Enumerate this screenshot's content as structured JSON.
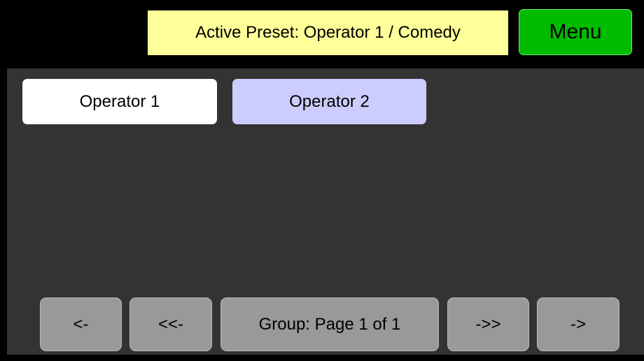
{
  "header": {
    "active_preset_label": "Active Preset: Operator 1 / Comedy",
    "menu_label": "Menu"
  },
  "operators": [
    {
      "label": "Operator 1",
      "selected": true,
      "color": "#ffffff"
    },
    {
      "label": "Operator 2",
      "selected": false,
      "color": "#ccccff"
    }
  ],
  "navigation": {
    "prev_label": "<-",
    "prev_group_label": "<<-",
    "page_label": "Group: Page 1 of 1",
    "next_group_label": "->>",
    "next_label": "->"
  },
  "colors": {
    "background": "#000000",
    "panel": "#333333",
    "preset_banner": "#ffff99",
    "menu_button": "#00bb00",
    "nav_button": "#999999"
  }
}
